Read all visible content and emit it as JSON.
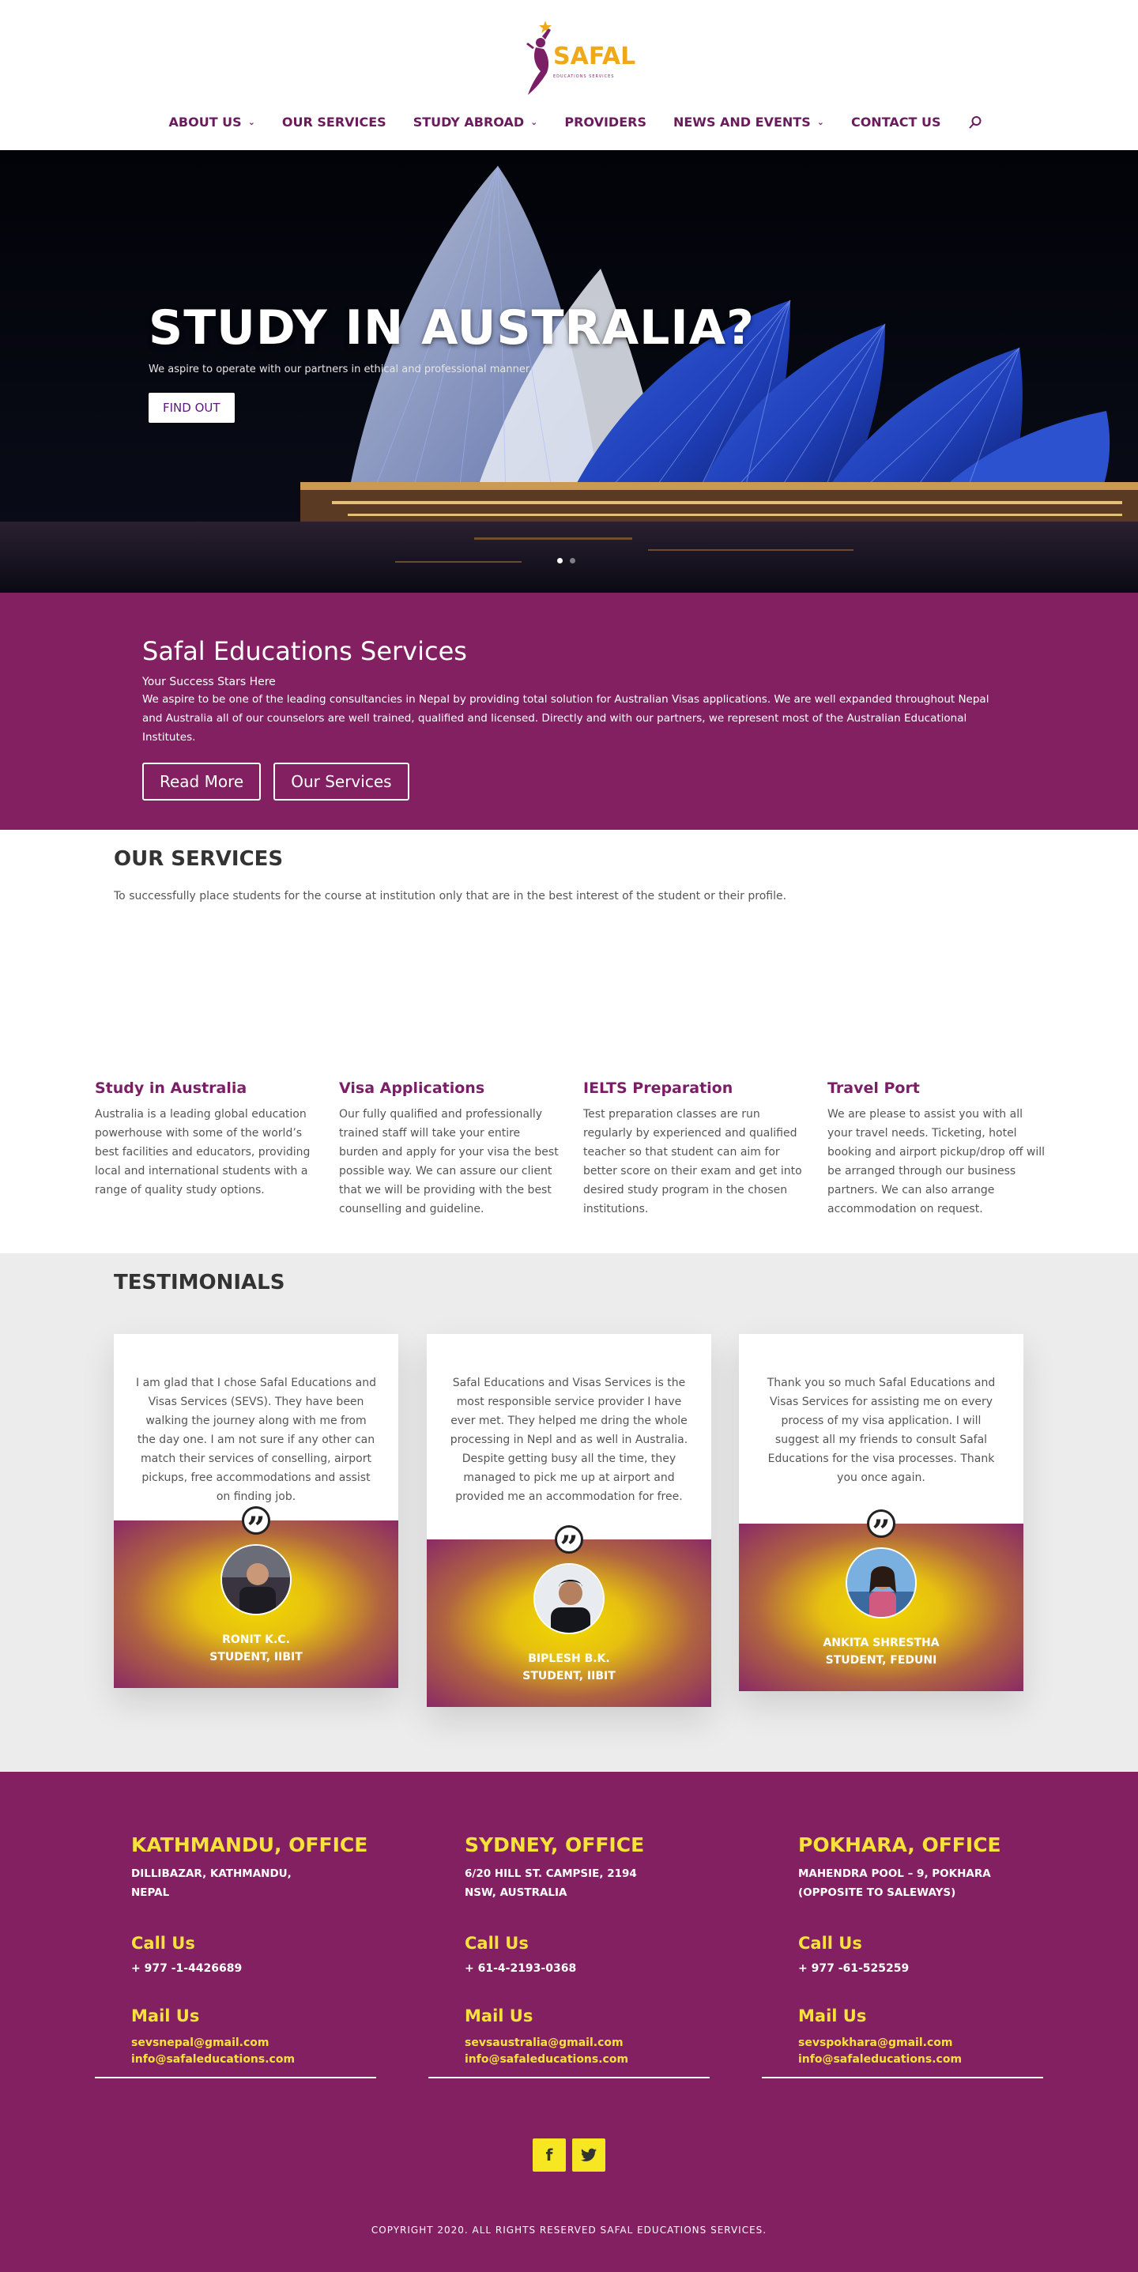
{
  "brand": {
    "logo_text": "SAFAL",
    "logo_subtext": "EDUCATIONS SERVICES",
    "colors": {
      "primary": "#822062",
      "accent": "#f7e23a",
      "nav": "#6a1b5c"
    }
  },
  "nav": {
    "items": [
      {
        "label": "ABOUT US",
        "dropdown": true
      },
      {
        "label": "OUR SERVICES",
        "dropdown": false
      },
      {
        "label": "STUDY ABROAD",
        "dropdown": true
      },
      {
        "label": "PROVIDERS",
        "dropdown": false
      },
      {
        "label": "NEWS AND EVENTS",
        "dropdown": true
      },
      {
        "label": "CONTACT US",
        "dropdown": false
      }
    ],
    "search_icon": "search-icon",
    "caret_glyph": "⌄"
  },
  "hero": {
    "title": "STUDY IN AUSTRALIA?",
    "subtitle": "We aspire to operate with our partners in ethical and professional manner.",
    "button": "FIND OUT",
    "slides_active": 1,
    "slides_total": 2
  },
  "about": {
    "title": "Safal Educations Services",
    "tagline": "Your Success Stars Here",
    "text": "We aspire to be one of the leading consultancies in Nepal by providing total solution for Australian Visas applications. We are well expanded throughout Nepal and Australia all of our counselors are well trained, qualified and licensed. Directly and with our partners, we represent most of the Australian Educational Institutes.",
    "read_more": "Read More",
    "our_services": "Our Services"
  },
  "services": {
    "title": "OUR SERVICES",
    "description": "To successfully place students for the course at institution only that are in the best interest of the student or their profile.",
    "items": [
      {
        "title": "Study in Australia",
        "text": "Australia is a leading global education powerhouse with some of the world’s best facilities and educators, providing local and international students with a range of quality study options."
      },
      {
        "title": "Visa Applications",
        "text": "Our fully qualified and professionally trained staff will take your entire burden and apply for your visa the best possible way. We can assure our client that we will be providing with the best counselling and guideline."
      },
      {
        "title": "IELTS Preparation",
        "text": "Test preparation classes are run regularly by experienced and qualified teacher so that student can aim for better score on their exam and get into desired study program in the chosen institutions."
      },
      {
        "title": "Travel Port",
        "text": "We are please to assist you with all your travel needs. Ticketing, hotel booking and airport pickup/drop off will be arranged through our business partners. We can also arrange accommodation on request."
      }
    ]
  },
  "testimonials": {
    "title": "TESTIMONIALS",
    "quote_glyph": "”",
    "items": [
      {
        "text": "I am glad that I chose Safal Educations and Visas Services (SEVS). They have been walking the journey along with me from the day one. I am not sure if any other can match their services of conselling, airport pickups, free accommodations and assist on finding job.",
        "name": "RONIT K.C.",
        "role": "STUDENT, IIBIT"
      },
      {
        "text": "Safal Educations and Visas Services is the most responsible service provider I have ever met. They helped me dring the whole processing in Nepl and as well in Australia. Despite getting busy all the time, they managed to pick me up at airport and provided me an accommodation for free.",
        "name": "BIPLESH B.K.",
        "role": "STUDENT, IIBIT"
      },
      {
        "text": "Thank you so much Safal Educations and Visas Services for assisting me on every process of my visa application. I will suggest all my friends to consult Safal Educations for the visa processes. Thank you once again.",
        "name": "ANKITA SHRESTHA",
        "role": "STUDENT, FEDUNI"
      }
    ]
  },
  "footer": {
    "call_heading": "Call Us",
    "mail_heading": "Mail Us",
    "offices": [
      {
        "title": "KATHMANDU, OFFICE",
        "addr1": "DILLIBAZAR, KATHMANDU,",
        "addr2": "NEPAL",
        "phone": "+ 977 -1-4426689",
        "mail1": "sevsnepal@gmail.com",
        "mail2": "info@safaleducations.com"
      },
      {
        "title": "SYDNEY, OFFICE",
        "addr1": "6/20 HILL ST. CAMPSIE, 2194",
        "addr2": "NSW, AUSTRALIA",
        "phone": "+ 61-4-2193-0368",
        "mail1": "sevsaustralia@gmail.com",
        "mail2": "info@safaleducations.com"
      },
      {
        "title": "POKHARA, OFFICE",
        "addr1": "MAHENDRA POOL – 9, POKHARA",
        "addr2": "(OPPOSITE TO SALEWAYS)",
        "phone": "+ 977 -61-525259",
        "mail1": "sevspokhara@gmail.com",
        "mail2": "info@safaleducations.com"
      }
    ],
    "social": [
      {
        "icon": "facebook-icon",
        "glyph": "f"
      },
      {
        "icon": "twitter-icon",
        "glyph": "t"
      }
    ],
    "copyright": "COPYRIGHT 2020. ALL RIGHTS RESERVED SAFAL EDUCATIONS SERVICES."
  }
}
